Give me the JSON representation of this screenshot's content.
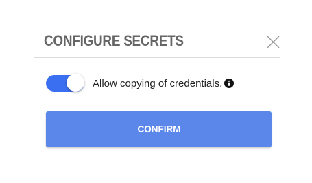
{
  "dialog": {
    "title": "CONFIGURE SECRETS",
    "close_icon": "close-icon",
    "toggle": {
      "checked": true,
      "label": "Allow copying of credentials.",
      "info_icon": "info-icon"
    },
    "confirm_label": "CONFIRM"
  },
  "colors": {
    "title": "#666666",
    "toggle_on": "#3a6ff1",
    "confirm_button": "#5c87ea",
    "divider": "#dcdcdc"
  }
}
